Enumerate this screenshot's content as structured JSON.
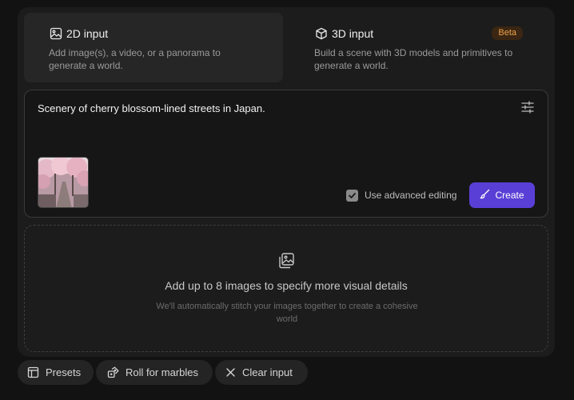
{
  "modes": [
    {
      "title": "2D input",
      "description": "Add image(s), a video, or a panorama to generate a world.",
      "icon": "image-icon"
    },
    {
      "title": "3D input",
      "description": "Build a scene with 3D models and primitives to generate a world.",
      "icon": "cube-icon",
      "badge": "Beta"
    }
  ],
  "prompt": {
    "text": "Scenery of cherry blossom-lined streets in Japan.",
    "advanced_label": "Use advanced editing",
    "advanced_checked": true,
    "create_label": "Create"
  },
  "dropzone": {
    "title": "Add up to 8 images to specify more visual details",
    "subtitle": "We'll automatically stitch your images together to create a cohesive world"
  },
  "footer": {
    "presets_label": "Presets",
    "roll_label": "Roll for marbles",
    "clear_label": "Clear input"
  },
  "colors": {
    "accent": "#5a3fd6",
    "beta": "#f0a24a"
  }
}
